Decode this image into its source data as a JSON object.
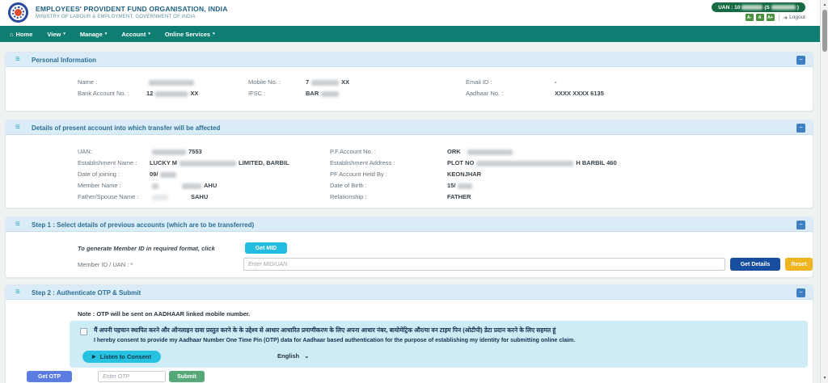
{
  "colors": {
    "nav_teal": "#0e7d72",
    "header_title_blue": "#1d6080",
    "section_header_bg": "#d9ecf7",
    "section_title_blue": "#2d6e95",
    "uan_badge_green": "#166b43",
    "get_mid_cyan": "#22bde0",
    "get_details_navy": "#174ea0",
    "reset_amber": "#f0b41e",
    "consent_box_cyan": "#cdecf6",
    "listen_pill_cyan": "#27c2e2",
    "get_otp_blue": "#5b7ce0",
    "submit_green": "#55a878"
  },
  "header": {
    "org_title": "EMPLOYEES' PROVIDENT FUND ORGANISATION, INDIA",
    "org_subtitle": "MINISTRY OF LABOUR & EMPLOYMENT, GOVERNMENT OF INDIA",
    "uan_pre": "UAN : 10",
    "uan_mid": "(S",
    "uan_post": ")",
    "font_small": "A-",
    "font_med": "A",
    "font_large": "A+",
    "logout_label": "Logout"
  },
  "nav": {
    "home": "Home",
    "view": "View",
    "manage": "Manage",
    "account": "Account",
    "online_services": "Online Services"
  },
  "personal": {
    "title": "Personal Information",
    "name_label": "Name :",
    "mobile_label": "Mobile No. :",
    "email_label": "Email ID :",
    "bank_label": "Bank Account No. :",
    "ifsc_label": "IFSC :",
    "aadhaar_label": "Aadhaar No. :",
    "mobile_pre": "7",
    "mobile_post": "XX",
    "email_value": "-",
    "bank_pre": "12",
    "bank_post": "XX",
    "ifsc_pre": "BAR",
    "aadhaar_value": "XXXX XXXX 6135"
  },
  "present": {
    "title": "Details of present account into which transfer will be affected",
    "uan_label": "UAN:",
    "est_name_label": "Establishment Name :",
    "doj_label": "Date of joining :",
    "member_label": "Member Name :",
    "father_label": "Father/Spouse Name :",
    "pf_label": "P.F.Account No. :",
    "est_addr_label": "Establishment Address :",
    "held_label": "PF Account Held By :",
    "dob_label": "Date of Birth :",
    "rel_label": "Relationship :",
    "uan_post": "7553",
    "est_name_pre": "LUCKY M",
    "est_name_post": "LIMITED, BARBIL",
    "doj_pre": "09/",
    "member_post": "AHU",
    "father_post": "SAHU",
    "pf_pre": "ORK",
    "est_addr_pre": "PLOT NO",
    "est_addr_post": "H BARBIL 460",
    "held_value": "KEONJHAR",
    "dob_pre": "15/",
    "rel_value": "FATHER"
  },
  "step1": {
    "title": "Step 1 : Select details of previous accounts (which are to be transferred)",
    "hint_text": "To generate Member ID in required format, click",
    "get_mid_label": "Get MID",
    "member_label": "Member ID / UAN : *",
    "member_placeholder": "Enter MID/UAN",
    "get_details_label": "Get Details",
    "reset_label": "Reset"
  },
  "step2": {
    "title": "Step 2 : Authenticate OTP & Submit",
    "note": "Note : OTP will be sent on AADHAAR linked mobile number.",
    "consent_hi": "मैं अपनी पहचान स्थापित करने और ऑनलाइन दावा प्रस्तुत करने के के उद्देश्य से आधार आधारित प्रमाणीकरण के लिए अपना आधार नंबर, बायोमेट्रिक और/या वन टाइम पिन (ओटीपी) डेटा प्रदान करने के लिए सहमत हूं",
    "consent_en": "I hereby consent to provide my Aadhaar Number One Time Pin (OTP) data for Aadhaar based authentication for the purpose of establishing my identity for submitting online claim.",
    "play_icon": "▶",
    "listen_label": "Listen to Consent",
    "language_value": "English",
    "get_otp_label": "Get OTP",
    "otp_placeholder": "Enter OTP",
    "submit_label": "Submit"
  },
  "icons": {
    "burger": "≡",
    "minus": "−",
    "home": "⌂",
    "caret_down": "▾",
    "chevron_down": "⌄",
    "logout_arrow": "➜",
    "scroll_up": "▲",
    "scroll_down": "▼"
  }
}
